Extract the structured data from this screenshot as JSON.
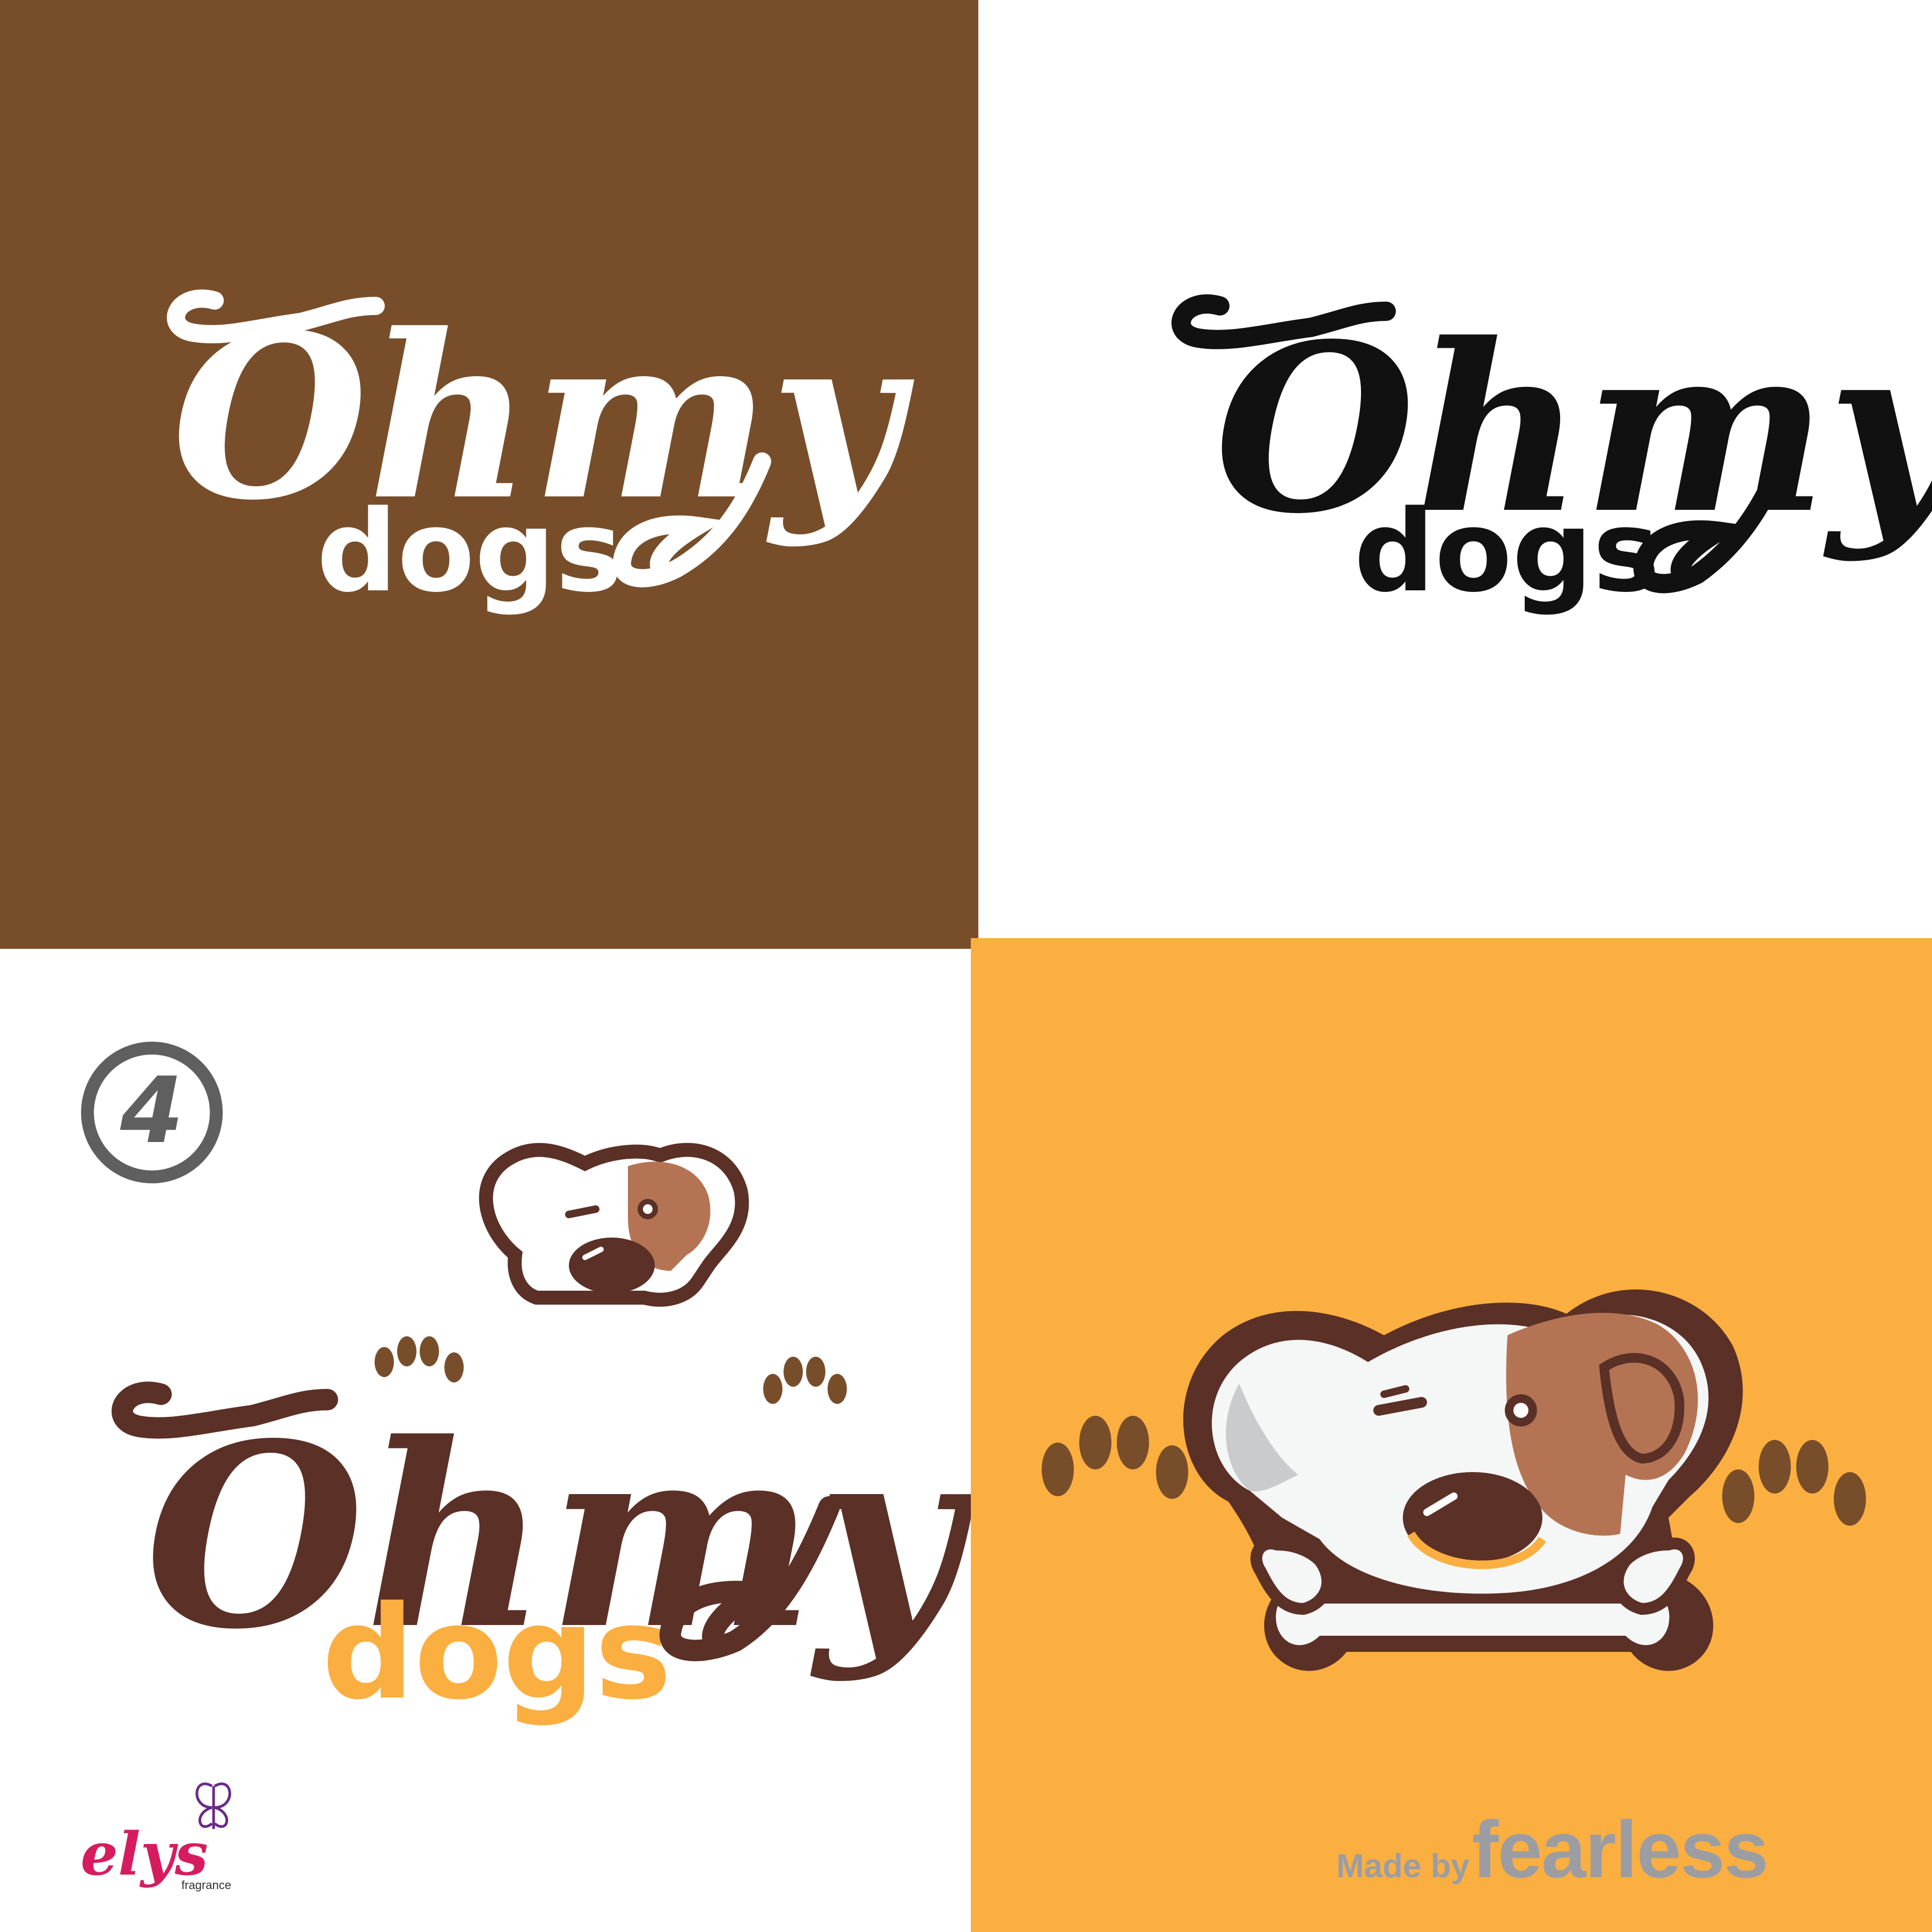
{
  "colors": {
    "brown_panel": "#784e2a",
    "orange_panel": "#fbaf40",
    "dark_brown": "#5b3026",
    "patch_brown": "#b47454",
    "paw_brown": "#784e2a",
    "gold": "#fbaf40",
    "gray_emblem": "#5f5f60",
    "credit_gray": "#9b9da3",
    "elys_pink": "#d61c5f",
    "elys_purple": "#6a2a86"
  },
  "logo": {
    "script_word": "Ohmy",
    "sub_word": "dogs"
  },
  "emblem": {
    "glyph": "4",
    "icon": "circle-4-emblem-icon"
  },
  "elys": {
    "name": "elys",
    "tagline": "fragrance",
    "icon": "butterfly-icon"
  },
  "credit": {
    "made_by": "Made by",
    "brand": "fearless"
  },
  "mascot": {
    "icon": "dog-with-bone-icon"
  }
}
